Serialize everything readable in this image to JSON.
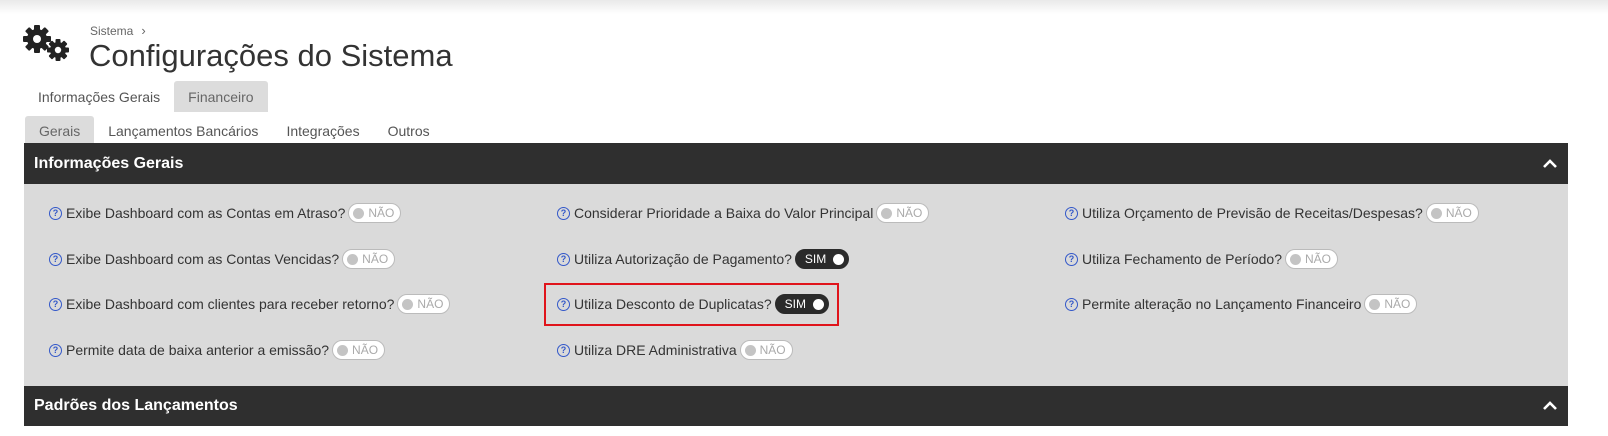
{
  "breadcrumb": {
    "parent": "Sistema",
    "separator": "›"
  },
  "page_title": "Configurações do Sistema",
  "top_tabs": [
    {
      "label": "Informações Gerais",
      "active": false
    },
    {
      "label": "Financeiro",
      "active": true
    }
  ],
  "sub_tabs": [
    {
      "label": "Gerais",
      "active": true
    },
    {
      "label": "Lançamentos Bancários",
      "active": false
    },
    {
      "label": "Integrações",
      "active": false
    },
    {
      "label": "Outros",
      "active": false
    }
  ],
  "sections": [
    {
      "title": "Informações Gerais",
      "expanded": true
    },
    {
      "title": "Padrões dos Lançamentos",
      "expanded": true
    }
  ],
  "toggle_labels": {
    "on": "SIM",
    "off": "NÃO"
  },
  "settings": [
    {
      "label": "Exibe Dashboard com as Contas em Atraso?",
      "value": "NÃO"
    },
    {
      "label": "Exibe Dashboard com as Contas Vencidas?",
      "value": "NÃO"
    },
    {
      "label": "Exibe Dashboard com clientes para receber retorno?",
      "value": "NÃO"
    },
    {
      "label": "Permite data de baixa anterior a emissão?",
      "value": "NÃO"
    },
    {
      "label": "Considerar Prioridade a Baixa do Valor Principal",
      "value": "NÃO"
    },
    {
      "label": "Utiliza Autorização de Pagamento?",
      "value": "SIM"
    },
    {
      "label": "Utiliza Desconto de Duplicatas?",
      "value": "SIM"
    },
    {
      "label": "Utiliza DRE Administrativa",
      "value": "NÃO"
    },
    {
      "label": "Utiliza Orçamento de Previsão de Receitas/Despesas?",
      "value": "NÃO"
    },
    {
      "label": "Utiliza Fechamento de Período?",
      "value": "NÃO"
    },
    {
      "label": "Permite alteração no Lançamento Financeiro",
      "value": "NÃO"
    }
  ],
  "colors": {
    "header_bg": "#2f2f2f",
    "panel_bg": "#dadada",
    "help_icon": "#3358c9",
    "highlight": "#e0141b"
  }
}
